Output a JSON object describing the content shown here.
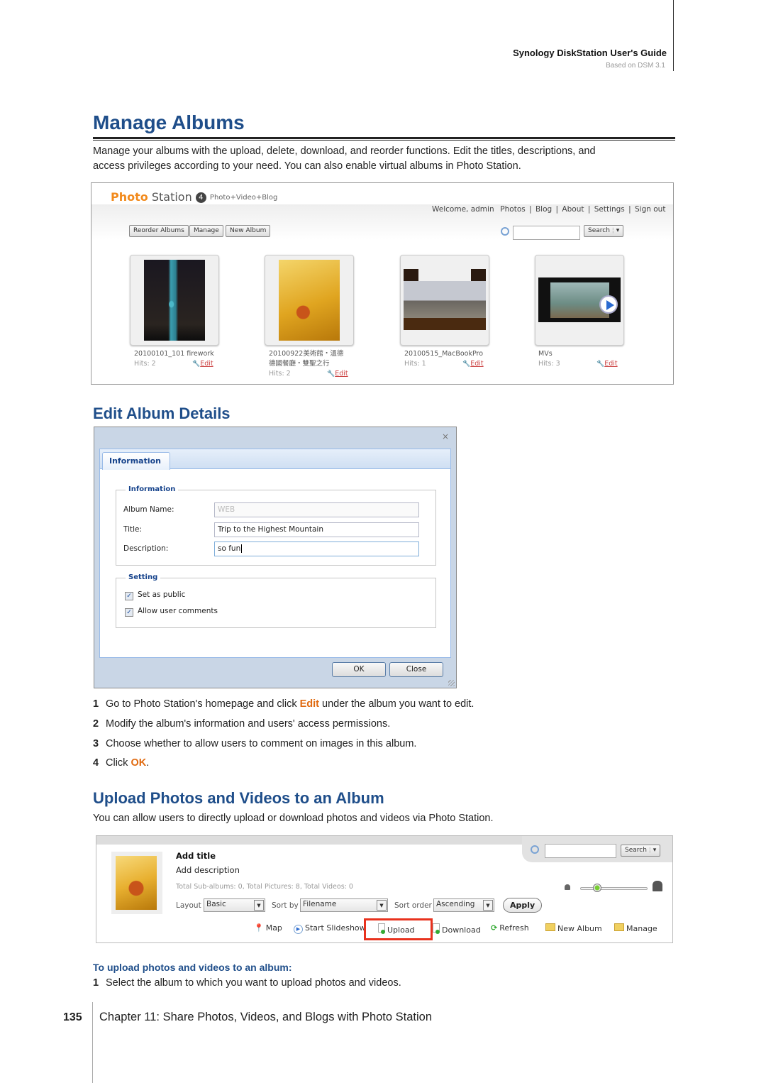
{
  "header": {
    "guide_title": "Synology DiskStation User's Guide",
    "guide_subtitle": "Based on DSM 3.1"
  },
  "section": {
    "title": "Manage Albums",
    "intro_line1": "Manage your albums with the upload, delete, download, and reorder functions. Edit the titles, descriptions, and",
    "intro_line2": "access privileges according to your need. You can also enable virtual albums in Photo Station."
  },
  "photo_station": {
    "logo_word1": "Photo",
    "logo_word2": "Station",
    "logo_version": "4",
    "logo_tagline": "Photo+Video+Blog",
    "nav": {
      "welcome": "Welcome, admin",
      "items": [
        "Photos",
        "Blog",
        "About",
        "Settings",
        "Sign out"
      ],
      "separator": "|"
    },
    "toolbar": {
      "reorder_label": "Reorder Albums",
      "manage_label": "Manage",
      "new_album_label": "New Album"
    },
    "search": {
      "value": "",
      "button_label": "Search",
      "dropdown_glyph": "▾"
    },
    "albums": [
      {
        "name_line1": "20100101_101 firework",
        "name_line2": "",
        "hits": "Hits: 2",
        "edit": "Edit"
      },
      {
        "name_line1": "20100922美術館・溫德",
        "name_line2": "德國餐廳・雙聖之行",
        "hits": "Hits: 2",
        "edit": "Edit"
      },
      {
        "name_line1": "20100515_MacBookPro",
        "name_line2": "",
        "hits": "Hits: 1",
        "edit": "Edit"
      },
      {
        "name_line1": "MVs",
        "name_line2": "",
        "hits": "Hits: 3",
        "edit": "Edit"
      }
    ]
  },
  "edit_section": {
    "title": "Edit Album Details"
  },
  "dialog": {
    "close_glyph": "×",
    "tab_label": "Information",
    "info_legend": "Information",
    "album_name_label": "Album Name:",
    "album_name_value": "WEB",
    "title_label": "Title:",
    "title_value": "Trip to the Highest Mountain",
    "description_label": "Description:",
    "description_value": "so fun",
    "setting_legend": "Setting",
    "set_public_label": "Set as public",
    "set_public_checked": true,
    "allow_comments_label": "Allow user comments",
    "allow_comments_checked": true,
    "check_glyph": "✓",
    "ok_label": "OK",
    "close_label": "Close"
  },
  "steps": [
    {
      "num": "1",
      "pre": "Go to Photo Station's homepage and click ",
      "highlight": "Edit",
      "post": " under the album you want to edit."
    },
    {
      "num": "2",
      "pre": "Modify the album's information and users' access permissions.",
      "highlight": "",
      "post": ""
    },
    {
      "num": "3",
      "pre": "Choose whether to allow users to comment on images in this album.",
      "highlight": "",
      "post": ""
    },
    {
      "num": "4",
      "pre": "Click ",
      "highlight": "OK",
      "post": "."
    }
  ],
  "upload_section": {
    "title": "Upload Photos and Videos to an Album",
    "intro": "You can allow users to directly upload or download photos and videos via Photo Station."
  },
  "album_view": {
    "add_title": "Add title",
    "add_description": "Add description",
    "totals": "Total Sub-albums: 0, Total Pictures: 8, Total Videos: 0",
    "layout_label": "Layout",
    "layout_value": "Basic",
    "sort_by_label": "Sort by",
    "sort_by_value": "Filename",
    "sort_order_label": "Sort order",
    "sort_order_value": "Ascending",
    "apply_label": "Apply",
    "search_value": "",
    "search_label": "Search",
    "actions": {
      "map": "Map",
      "slideshow": "Start Slideshow",
      "upload": "Upload",
      "download": "Download",
      "refresh": "Refresh",
      "new_album": "New Album",
      "manage": "Manage"
    },
    "highlight_color": "#e8321e"
  },
  "procedure": {
    "title": "To upload photos and videos to an album:",
    "steps": [
      {
        "num": "1",
        "text": "Select the album to which you want to upload photos and videos."
      }
    ]
  },
  "footer": {
    "page_number": "135",
    "chapter": "Chapter 11: Share Photos, Videos, and Blogs with Photo Station"
  },
  "colors": {
    "heading_blue": "#1f4e8a",
    "highlight_orange": "#e06a10",
    "logo_orange": "#f28a1c"
  }
}
